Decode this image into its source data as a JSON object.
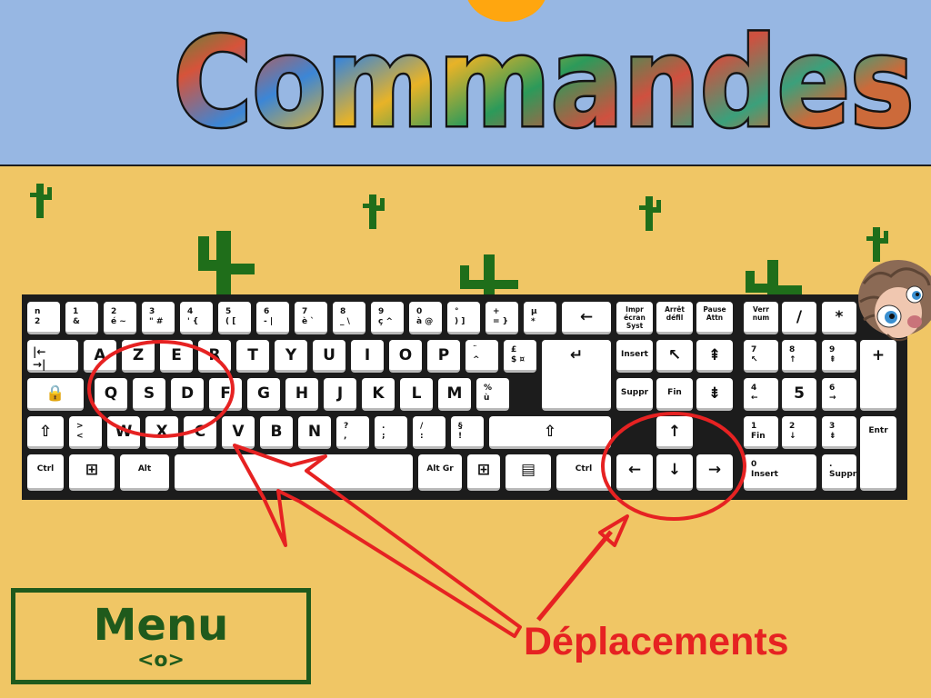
{
  "title": "Commandes",
  "menu": {
    "label": "Menu",
    "key": "<o>"
  },
  "annotation": {
    "label": "Déplacements"
  },
  "colors": {
    "sky": "#97b7e3",
    "sand": "#f0c665",
    "sun": "#ffa60f",
    "cactus": "#1f6e1a",
    "menu": "#1f5a1c",
    "annotation": "#e62222",
    "keyboard": "#1c1c1c"
  },
  "icons": [
    "sun-icon",
    "cactus-icon",
    "pangolin-mascot",
    "windows-logo-icon",
    "context-menu-icon"
  ],
  "keys": [
    {
      "id": "key-superscript-2",
      "label": "n\n2"
    },
    {
      "id": "key-1",
      "label": "1\n&"
    },
    {
      "id": "key-2",
      "label": "2\né ~"
    },
    {
      "id": "key-3",
      "label": "3\n\" #"
    },
    {
      "id": "key-4",
      "label": "4\n' {"
    },
    {
      "id": "key-5",
      "label": "5\n( ["
    },
    {
      "id": "key-6",
      "label": "6\n- |"
    },
    {
      "id": "key-7",
      "label": "7\nè `"
    },
    {
      "id": "key-8",
      "label": "8\n_ \\"
    },
    {
      "id": "key-9",
      "label": "9\nç ^"
    },
    {
      "id": "key-0",
      "label": "0\nà @"
    },
    {
      "id": "key-degree",
      "label": "°\n) ]"
    },
    {
      "id": "key-plus",
      "label": "+\n= }"
    },
    {
      "id": "key-micro",
      "label": "µ\n*"
    },
    {
      "id": "key-backspace",
      "label": "←"
    },
    {
      "id": "key-tab",
      "label": "|←\n→|"
    },
    {
      "id": "key-a",
      "label": "A"
    },
    {
      "id": "key-z",
      "label": "Z"
    },
    {
      "id": "key-e",
      "label": "E"
    },
    {
      "id": "key-r",
      "label": "R"
    },
    {
      "id": "key-t",
      "label": "T"
    },
    {
      "id": "key-y",
      "label": "Y"
    },
    {
      "id": "key-u",
      "label": "U"
    },
    {
      "id": "key-i",
      "label": "I"
    },
    {
      "id": "key-o",
      "label": "O"
    },
    {
      "id": "key-p",
      "label": "P"
    },
    {
      "id": "key-circumflex",
      "label": "¨\n^"
    },
    {
      "id": "key-pound",
      "label": "£\n$ ¤"
    },
    {
      "id": "key-caps-lock",
      "label": "🔒"
    },
    {
      "id": "key-q",
      "label": "Q"
    },
    {
      "id": "key-s",
      "label": "S"
    },
    {
      "id": "key-d",
      "label": "D"
    },
    {
      "id": "key-f",
      "label": "F"
    },
    {
      "id": "key-g",
      "label": "G"
    },
    {
      "id": "key-h",
      "label": "H"
    },
    {
      "id": "key-j",
      "label": "J"
    },
    {
      "id": "key-k",
      "label": "K"
    },
    {
      "id": "key-l",
      "label": "L"
    },
    {
      "id": "key-m",
      "label": "M"
    },
    {
      "id": "key-percent",
      "label": "%\nù"
    },
    {
      "id": "key-star",
      "label": ""
    },
    {
      "id": "key-enter",
      "label": "↵"
    },
    {
      "id": "key-shift-left",
      "label": "⇧"
    },
    {
      "id": "key-angle",
      "label": ">\n<"
    },
    {
      "id": "key-w",
      "label": "W"
    },
    {
      "id": "key-x",
      "label": "X"
    },
    {
      "id": "key-c",
      "label": "C"
    },
    {
      "id": "key-v",
      "label": "V"
    },
    {
      "id": "key-b",
      "label": "B"
    },
    {
      "id": "key-n",
      "label": "N"
    },
    {
      "id": "key-question",
      "label": "?\n,"
    },
    {
      "id": "key-period",
      "label": ".\n;"
    },
    {
      "id": "key-slash",
      "label": "/\n:"
    },
    {
      "id": "key-section",
      "label": "§\n!"
    },
    {
      "id": "key-shift-right",
      "label": "⇧"
    },
    {
      "id": "key-ctrl-left",
      "label": "Ctrl"
    },
    {
      "id": "key-win-left",
      "label": "⊞"
    },
    {
      "id": "key-alt",
      "label": "Alt"
    },
    {
      "id": "key-space",
      "label": ""
    },
    {
      "id": "key-altgr",
      "label": "Alt Gr"
    },
    {
      "id": "key-win-right",
      "label": "⊞"
    },
    {
      "id": "key-menu",
      "label": "▤"
    },
    {
      "id": "key-ctrl-right",
      "label": "Ctrl"
    },
    {
      "id": "key-print-screen",
      "label": "Impr\nécran\nSyst"
    },
    {
      "id": "key-scroll-lock",
      "label": "Arrêt\ndéfil"
    },
    {
      "id": "key-pause",
      "label": "Pause\nAttn"
    },
    {
      "id": "key-insert",
      "label": "Insert"
    },
    {
      "id": "key-home",
      "label": "↖"
    },
    {
      "id": "key-page-up",
      "label": "⇞"
    },
    {
      "id": "key-delete",
      "label": "Suppr"
    },
    {
      "id": "key-end",
      "label": "Fin"
    },
    {
      "id": "key-page-down",
      "label": "⇟"
    },
    {
      "id": "key-arrow-up",
      "label": "↑"
    },
    {
      "id": "key-arrow-left",
      "label": "←"
    },
    {
      "id": "key-arrow-down",
      "label": "↓"
    },
    {
      "id": "key-arrow-right",
      "label": "→"
    },
    {
      "id": "key-num-lock",
      "label": "Verr\nnum"
    },
    {
      "id": "key-num-divide",
      "label": "/"
    },
    {
      "id": "key-num-multiply",
      "label": "*"
    },
    {
      "id": "key-num-minus",
      "label": "-"
    },
    {
      "id": "key-num-7",
      "label": "7\n↖"
    },
    {
      "id": "key-num-8",
      "label": "8\n↑"
    },
    {
      "id": "key-num-9",
      "label": "9\n⇞"
    },
    {
      "id": "key-num-plus",
      "label": "+"
    },
    {
      "id": "key-num-4",
      "label": "4\n←"
    },
    {
      "id": "key-num-5",
      "label": "5"
    },
    {
      "id": "key-num-6",
      "label": "6\n→"
    },
    {
      "id": "key-num-1",
      "label": "1\nFin"
    },
    {
      "id": "key-num-2",
      "label": "2\n↓"
    },
    {
      "id": "key-num-3",
      "label": "3\n⇟"
    },
    {
      "id": "key-num-enter",
      "label": "Entr"
    },
    {
      "id": "key-num-0",
      "label": "0\nInsert"
    },
    {
      "id": "key-num-decimal",
      "label": ".\nSuppr"
    }
  ]
}
